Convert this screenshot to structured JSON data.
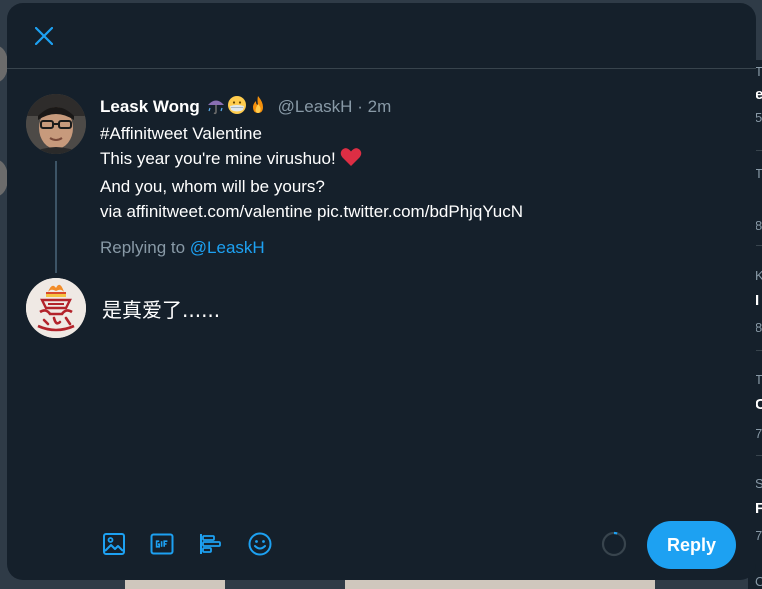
{
  "modal": {
    "close_icon": "close-icon"
  },
  "parent_tweet": {
    "author_name": "Leask Wong",
    "name_emojis": [
      "umbrella-with-rain-icon",
      "face-with-mask-icon",
      "fire-icon"
    ],
    "handle": "@LeaskH",
    "separator": "·",
    "time": "2m",
    "lines": [
      "#Affinitweet Valentine",
      "This year you're mine virushuo!",
      "And you, whom will be yours?",
      "via affinitweet.com/valentine pic.twitter.com/bdPhjqYucN"
    ],
    "heart_icon": "red-heart-icon"
  },
  "replying": {
    "prefix": "Replying to",
    "mention": "@LeaskH"
  },
  "compose": {
    "text": "是真爱了......"
  },
  "toolbar": {
    "icons": [
      "media-icon",
      "gif-icon",
      "poll-icon",
      "emoji-icon"
    ]
  },
  "reply_button": {
    "label": "Reply"
  },
  "background": {
    "fragments": [
      "T",
      "e",
      "5",
      "T",
      "8",
      "K",
      "I",
      "8",
      "T",
      "C",
      "7",
      "S",
      "F",
      "7",
      "Ch"
    ]
  },
  "colors": {
    "accent": "#1da1f2",
    "background": "#15202b",
    "secondary_text": "#8899a6",
    "border": "#38444d"
  }
}
